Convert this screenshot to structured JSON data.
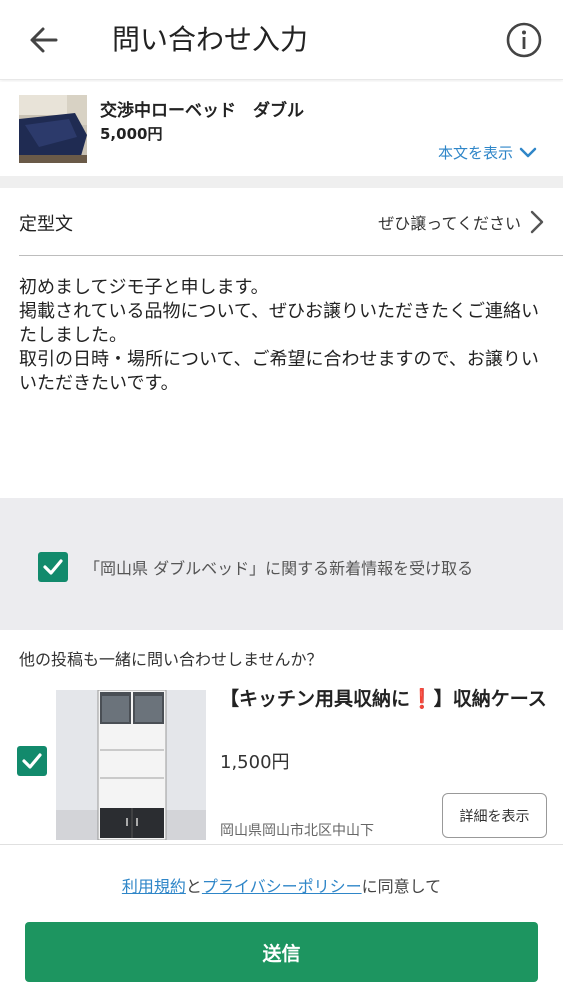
{
  "header": {
    "title": "問い合わせ入力",
    "back_icon": "arrow-left-icon",
    "info_icon": "info-circle-icon"
  },
  "product": {
    "name": "交渉中ローベッド　ダブル",
    "price": "5,000円",
    "show_body_label": "本文を表示"
  },
  "template": {
    "label": "定型文",
    "value": "ぜひ譲ってください"
  },
  "message": {
    "text": "初めましてジモ子と申します。\n掲載されている品物について、ぜひお譲りいただきたくご連絡いたしました。\n取引の日時・場所について、ご希望に合わせますので、お譲りいいただきたいです。"
  },
  "notify": {
    "checked": true,
    "label": "「岡山県 ダブルベッド」に関する新着情報を受け取る"
  },
  "others": {
    "title": "他の投稿も一緒に問い合わせしませんか？",
    "items": [
      {
        "checked": true,
        "title_before": "【キッチン用具収納に",
        "title_mark": "❗",
        "title_after": "】収納ケース",
        "price": "1,500円",
        "location": "岡山県岡山市北区中山下",
        "detail_label": "詳細を表示"
      }
    ]
  },
  "footer": {
    "terms_link": "利用規約",
    "and": "と",
    "privacy_link": "プライバシーポリシー",
    "agree_suffix": "に同意して",
    "send_label": "送信"
  },
  "colors": {
    "accent_green": "#128a6c",
    "send_green": "#1d9560",
    "link_blue": "#2f86c8",
    "alert_red": "#e02020"
  }
}
